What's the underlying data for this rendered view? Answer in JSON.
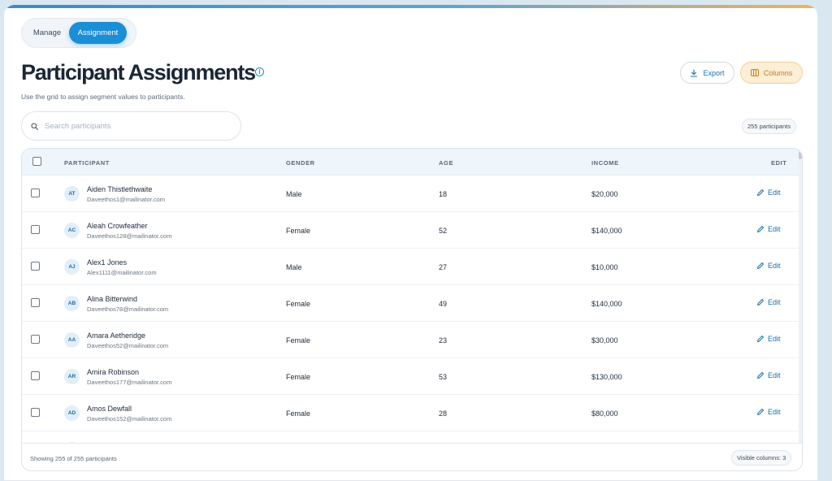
{
  "tabs": [
    {
      "label": "Manage",
      "active": false
    },
    {
      "label": "Assignment",
      "active": true
    }
  ],
  "header": {
    "title": "Participant Assignments",
    "subtitle": "Use the grid to assign segment values to participants.",
    "export_label": "Export",
    "columns_label": "Columns"
  },
  "search": {
    "placeholder": "Search participants",
    "value": ""
  },
  "count_badge": "255 participants",
  "grid": {
    "columns": [
      "PARTICIPANT",
      "GENDER",
      "AGE",
      "INCOME",
      "EDIT"
    ],
    "edit_label": "Edit",
    "rows": [
      {
        "initials": "AT",
        "name": "Aiden Thistlethwaite",
        "email": "Daveethos1@mailinator.com",
        "gender": "Male",
        "age": "18",
        "income": "$20,000"
      },
      {
        "initials": "AC",
        "name": "Aleah Crowfeather",
        "email": "Daveethos128@mailinator.com",
        "gender": "Female",
        "age": "52",
        "income": "$140,000"
      },
      {
        "initials": "AJ",
        "name": "Alex1 Jones",
        "email": "Alex1111@mailinator.com",
        "gender": "Male",
        "age": "27",
        "income": "$10,000"
      },
      {
        "initials": "AB",
        "name": "Alina Bitterwind",
        "email": "Daveethos78@mailinator.com",
        "gender": "Female",
        "age": "49",
        "income": "$140,000"
      },
      {
        "initials": "AA",
        "name": "Amara Aetheridge",
        "email": "Daveethos52@mailinator.com",
        "gender": "Female",
        "age": "23",
        "income": "$30,000"
      },
      {
        "initials": "AR",
        "name": "Amira Robinson",
        "email": "Daveethos177@mailinator.com",
        "gender": "Female",
        "age": "53",
        "income": "$130,000"
      },
      {
        "initials": "AD",
        "name": "Amos Dewfall",
        "email": "Daveethos152@mailinator.com",
        "gender": "Female",
        "age": "28",
        "income": "$80,000"
      }
    ],
    "footer_text": "Showing 255 of 255 participants",
    "visible_columns": "Visible columns: 3"
  },
  "colors": {
    "accent": "#1a8fd6",
    "columns_bg": "#fdeed6",
    "columns_text": "#c77a12"
  },
  "icons": {
    "info": "info-icon",
    "export": "download-icon",
    "columns": "columns-icon",
    "search": "search-icon",
    "edit": "pencil-icon"
  }
}
